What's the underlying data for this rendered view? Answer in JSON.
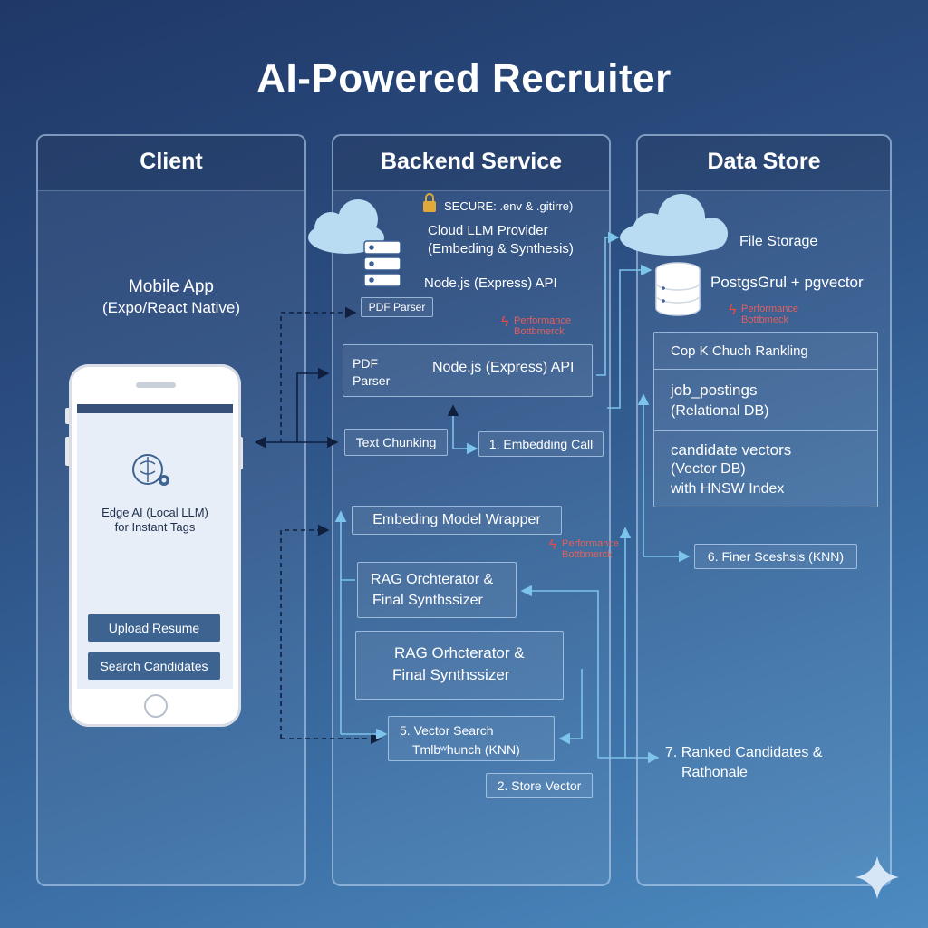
{
  "title": "AI-Powered Recruiter",
  "panels": {
    "client": "Client",
    "backend": "Backend Service",
    "data": "Data Store"
  },
  "client": {
    "app_line1": "Mobile App",
    "app_line2": "(Expo/React Native)",
    "edge_line1": "Edge AI (Local LLM)",
    "edge_line2": "for Instant Tags",
    "upload_label": "Upload Resume",
    "search_label": "Search Candidates"
  },
  "backend": {
    "secure": "SECURE: .env & .gitirre)",
    "cloud_line1": "Cloud LLM Provider",
    "cloud_line2": "(Embeding & Synthesis)",
    "node_api": "Node.js (Express) API",
    "pdf_parser_small": "PDF Parser",
    "perf1_line1": "Performance",
    "perf1_line2": "Bottbmerck",
    "box_pdf_line1": "PDF",
    "box_pdf_line2": "Parser",
    "box_node_api": "Node.js (Express) API",
    "text_chunking": "Text Chunking",
    "embedding_call": "1. Embedding Call",
    "embed_wrapper": "Embeding Model Wrapper",
    "perf2_line1": "Performance",
    "perf2_line2": "Bottbmerck",
    "rag1_line1": "RAG Orchterator &",
    "rag1_line2": "Final Synthssizer",
    "rag2_line1": "RAG Orhcterator &",
    "rag2_line2": "Final Synthssizer",
    "vector_line1": "5. Vector Search",
    "vector_line2": "Tmlbʷhunch (KNN)",
    "store_vector": "2. Store Vector"
  },
  "data": {
    "file_storage": "File Storage",
    "postgres": "PostgsGrul + pgvector",
    "perf_line1": "Performance",
    "perf_line2": "Bottbmeck",
    "ranking": "Cop K Chuch Rankling",
    "jobs_line1": "job_postings",
    "jobs_line2": "(Relational DB)",
    "cand_line1": "candidate vectors",
    "cand_line2": "(Vector DB)",
    "cand_line3": "with HNSW Index",
    "finer": "6. Finer Sceshsis (KNN)",
    "ranked_line1": "7. Ranked Candidates &",
    "ranked_line2": "Rathonale"
  },
  "colors": {
    "background_top": "#1f3868",
    "background_bottom": "#4d8bc0",
    "connector": "#7cc4ea",
    "dashed_connector": "#0f1f3d",
    "warning": "#e84a4a"
  }
}
